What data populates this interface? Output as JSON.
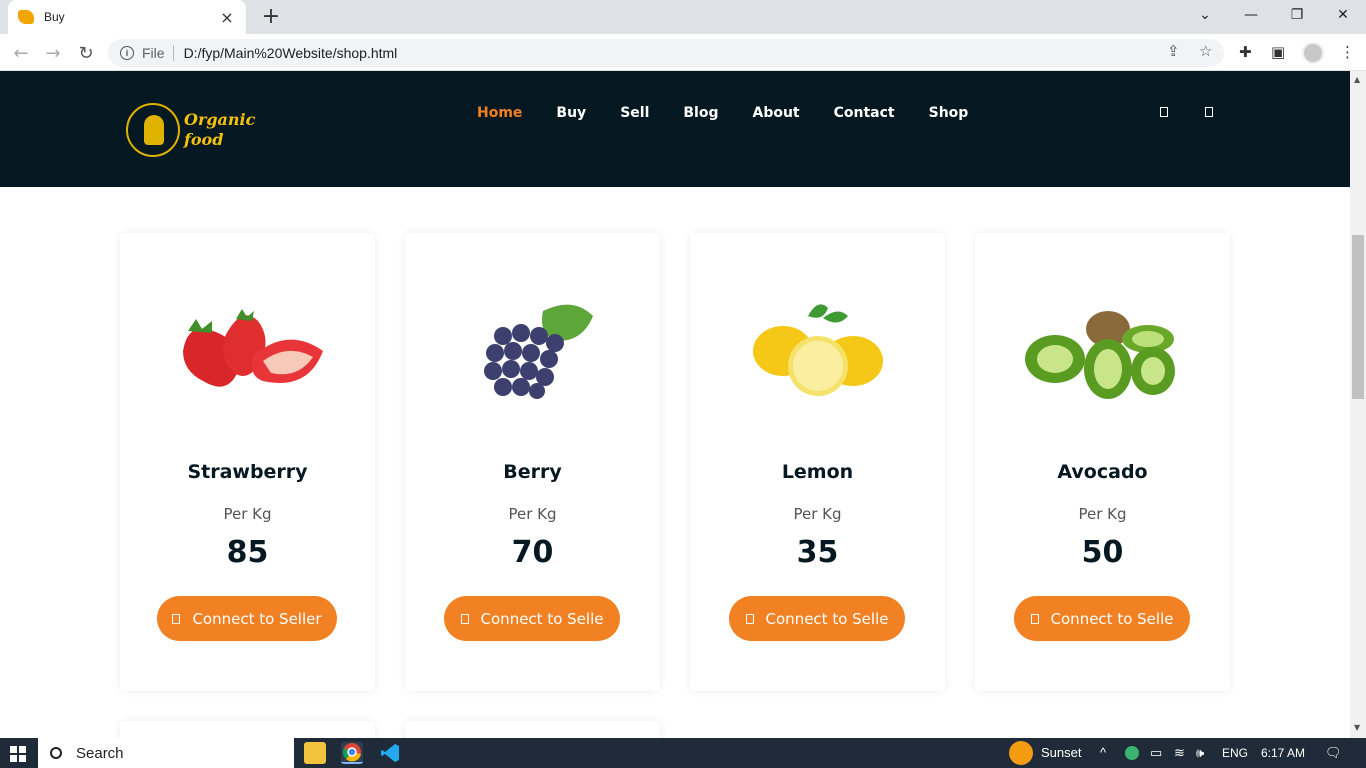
{
  "browser": {
    "tab_title": "Buy",
    "address_prefix": "File",
    "address_url": "D:/fyp/Main%20Website/shop.html"
  },
  "site": {
    "logo_line1": "Organic",
    "logo_line2": "food",
    "nav": [
      "Home",
      "Buy",
      "Sell",
      "Blog",
      "About",
      "Contact",
      "Shop"
    ],
    "active_nav": "Home",
    "accent_color": "#f28123",
    "header_color": "#061822"
  },
  "products": [
    {
      "name": "Strawberry",
      "unit": "Per Kg",
      "price": "85",
      "button": "Connect to Seller",
      "image_icon": "strawberry-image"
    },
    {
      "name": "Berry",
      "unit": "Per Kg",
      "price": "70",
      "button": "Connect to Selle",
      "image_icon": "grapes-image"
    },
    {
      "name": "Lemon",
      "unit": "Per Kg",
      "price": "35",
      "button": "Connect to Selle",
      "image_icon": "lemon-image"
    },
    {
      "name": "Avocado",
      "unit": "Per Kg",
      "price": "50",
      "button": "Connect to Selle",
      "image_icon": "kiwi-image"
    }
  ],
  "taskbar": {
    "search_label": "Search",
    "weather": "Sunset",
    "language": "ENG",
    "time": "6:17 AM"
  }
}
